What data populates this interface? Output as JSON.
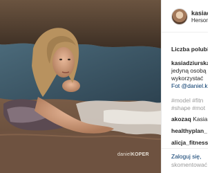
{
  "photo": {
    "alt": "",
    "watermark_light": "daniel",
    "watermark_bold": "KOPER"
  },
  "post": {
    "username": "kasiadziurska",
    "location": "Hersonissos",
    "likes_label": "Liczba polubień",
    "caption_lines": [
      "kasiadziurska",
      "jedyną osobą",
      "wykorzystać",
      "Fot @daniel.k"
    ],
    "hashtag_lines": [
      "#model #fitn",
      "#shape #mot"
    ],
    "comments": [
      {
        "user": "akozaq",
        "text": "Kasia"
      },
      {
        "user": "healthyplan_",
        "text": ""
      },
      {
        "user": "alicja_fitness",
        "text": ""
      }
    ],
    "login_prefix": "Zaloguj się,",
    "login_suffix": "skomentować"
  }
}
